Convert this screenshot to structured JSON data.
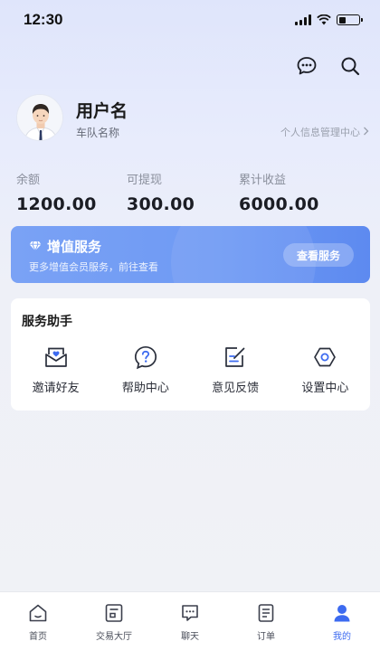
{
  "status_bar": {
    "time": "12:30"
  },
  "profile": {
    "user_name": "用户名",
    "team_name": "车队名称",
    "manage_link": "个人信息管理中心"
  },
  "stats": [
    {
      "label": "余额",
      "value": "1200.00"
    },
    {
      "label": "可提现",
      "value": "300.00"
    },
    {
      "label": "累计收益",
      "value": "6000.00"
    }
  ],
  "vip_card": {
    "title": "增值服务",
    "subtitle": "更多增值会员服务，前往查看",
    "button_label": "查看服务"
  },
  "services": {
    "title": "服务助手",
    "items": [
      {
        "label": "邀请好友",
        "icon": "invite-envelope-icon"
      },
      {
        "label": "帮助中心",
        "icon": "help-question-icon"
      },
      {
        "label": "意见反馈",
        "icon": "feedback-edit-icon"
      },
      {
        "label": "设置中心",
        "icon": "settings-hexagon-icon"
      }
    ]
  },
  "tab_bar": {
    "active": "我的",
    "items": [
      {
        "label": "首页",
        "icon": "home-icon"
      },
      {
        "label": "交易大厅",
        "icon": "trading-hall-icon"
      },
      {
        "label": "聊天",
        "icon": "chat-icon"
      },
      {
        "label": "订单",
        "icon": "order-icon"
      },
      {
        "label": "我的",
        "icon": "profile-icon"
      }
    ]
  },
  "colors": {
    "accent": "#3d6bf0",
    "vip_gradient_start": "#7aa2f5",
    "vip_gradient_end": "#5d8af0",
    "background": "#eef0f7"
  }
}
